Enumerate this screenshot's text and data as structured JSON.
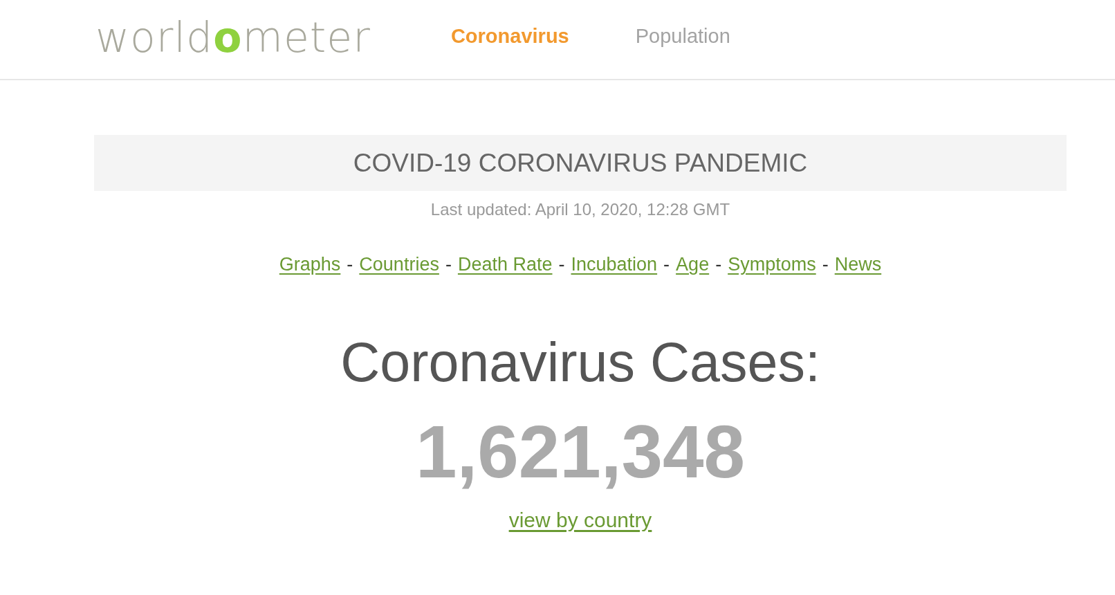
{
  "header": {
    "logo": {
      "parts": [
        {
          "text": "world",
          "accent": false
        },
        {
          "text": "o",
          "accent": true
        },
        {
          "text": "meter",
          "accent": false
        }
      ]
    },
    "nav": [
      {
        "label": "Coronavirus",
        "selected": true
      },
      {
        "label": "Population",
        "selected": false
      }
    ]
  },
  "banner": {
    "title": "COVID-19 CORONAVIRUS PANDEMIC"
  },
  "last_updated": "Last updated: April 10, 2020, 12:28 GMT",
  "quick_links": [
    {
      "label": "Graphs",
      "separator_after": "-"
    },
    {
      "label": "Countries",
      "separator_after": "-"
    },
    {
      "label": "Death Rate",
      "separator_after": "-"
    },
    {
      "label": "Incubation",
      "separator_after": "-"
    },
    {
      "label": "Age",
      "separator_after": "-"
    },
    {
      "label": "Symptoms",
      "separator_after": "-"
    },
    {
      "label": "News"
    }
  ],
  "counter": {
    "label": "Coronavirus Cases:",
    "value": "1,621,348",
    "link": "view by country"
  }
}
